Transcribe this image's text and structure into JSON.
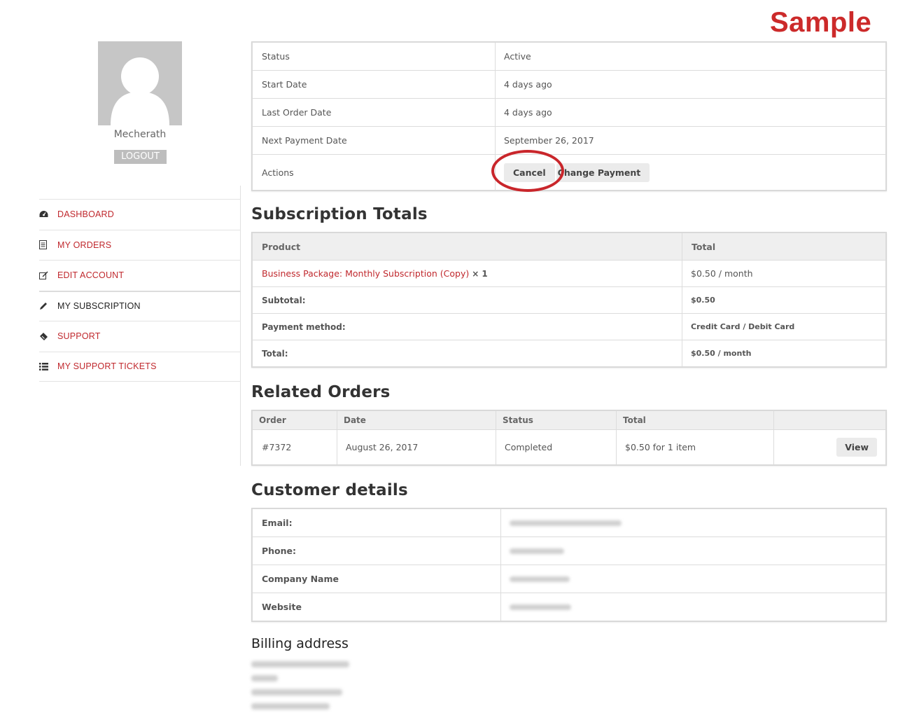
{
  "watermark": "Sample",
  "user": {
    "name": "Mecherath",
    "logout_label": "LOGOUT"
  },
  "nav": [
    {
      "label": "DASHBOARD",
      "icon": "dashboard-icon"
    },
    {
      "label": "MY ORDERS",
      "icon": "document-icon"
    },
    {
      "label": "EDIT ACCOUNT",
      "icon": "edit-icon"
    },
    {
      "label": "MY SUBSCRIPTION",
      "icon": "pencil-icon",
      "active": true
    },
    {
      "label": "SUPPORT",
      "icon": "ticket-icon"
    },
    {
      "label": "MY SUPPORT TICKETS",
      "icon": "list-icon"
    }
  ],
  "subscription": {
    "status_label": "Status",
    "status_value": "Active",
    "start_label": "Start Date",
    "start_value": "4 days ago",
    "last_order_label": "Last Order Date",
    "last_order_value": "4 days ago",
    "next_payment_label": "Next Payment Date",
    "next_payment_value": "September 26, 2017",
    "actions_label": "Actions",
    "cancel_label": "Cancel",
    "change_payment_label": "Change Payment"
  },
  "totals": {
    "heading": "Subscription Totals",
    "col_product": "Product",
    "col_total": "Total",
    "product_name": "Business Package: Monthly Subscription (Copy)",
    "product_qty": "× 1",
    "product_total": "$0.50 / month",
    "subtotal_label": "Subtotal:",
    "subtotal_value": "$0.50",
    "payment_label": "Payment method:",
    "payment_value": "Credit Card / Debit Card",
    "total_label": "Total:",
    "total_value": "$0.50 / month"
  },
  "related": {
    "heading": "Related Orders",
    "columns": [
      "Order",
      "Date",
      "Status",
      "Total"
    ],
    "rows": [
      {
        "order": "#7372",
        "date": "August 26, 2017",
        "status": "Completed",
        "total": "$0.50 for 1 item",
        "action": "View"
      }
    ]
  },
  "customer": {
    "heading": "Customer details",
    "email_label": "Email:",
    "phone_label": "Phone:",
    "company_label": "Company Name",
    "website_label": "Website"
  },
  "billing": {
    "heading": "Billing address"
  },
  "colors": {
    "accent": "#c0282d",
    "highlight_circle": "#c9262b"
  }
}
